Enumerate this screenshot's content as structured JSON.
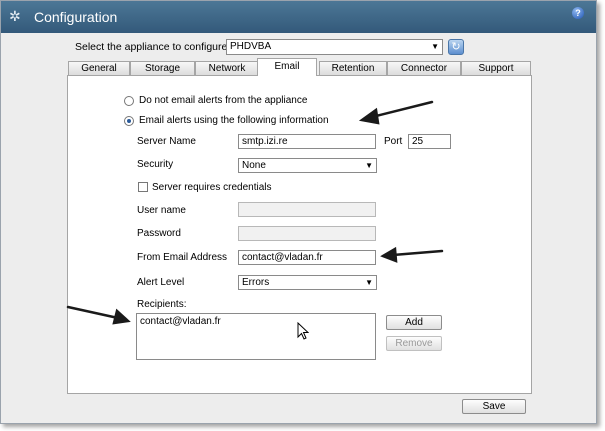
{
  "window": {
    "title": "Configuration",
    "help_icon": "?"
  },
  "appliance": {
    "label": "Select the appliance to configure:",
    "selected": "PHDVBA"
  },
  "tabs": [
    {
      "label": "General"
    },
    {
      "label": "Storage"
    },
    {
      "label": "Network"
    },
    {
      "label": "Email",
      "active": true
    },
    {
      "label": "Retention"
    },
    {
      "label": "Connector"
    },
    {
      "label": "Support"
    }
  ],
  "email": {
    "option_none": "Do not email alerts from the appliance",
    "option_use": "Email alerts using the following information",
    "server_name_label": "Server Name",
    "server_name_value": "smtp.izi.re",
    "port_label": "Port",
    "port_value": "25",
    "security_label": "Security",
    "security_value": "None",
    "credentials_label": "Server requires credentials",
    "username_label": "User name",
    "password_label": "Password",
    "from_label": "From Email Address",
    "from_value": "contact@vladan.fr",
    "alert_label": "Alert Level",
    "alert_value": "Errors",
    "recipients_label": "Recipients:",
    "recipients_value": "contact@vladan.fr",
    "add_label": "Add",
    "remove_label": "Remove"
  },
  "footer": {
    "save_label": "Save"
  }
}
